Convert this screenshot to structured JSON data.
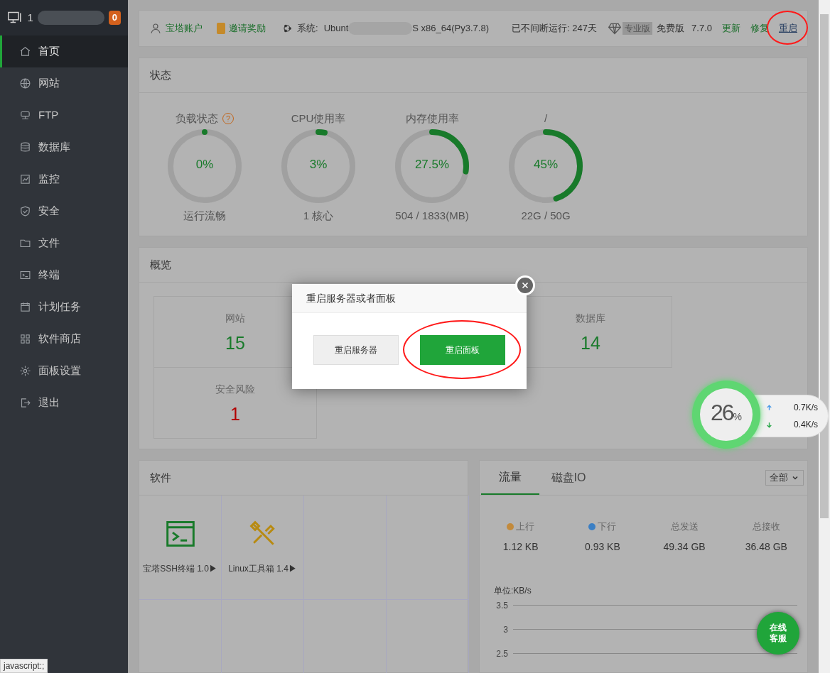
{
  "sidebar": {
    "host": "1",
    "badge": "0",
    "items": [
      {
        "label": "首页",
        "kind": "home",
        "selected": true
      },
      {
        "label": "网站",
        "kind": "globe",
        "selected": false
      },
      {
        "label": "FTP",
        "kind": "ftp",
        "selected": false
      },
      {
        "label": "数据库",
        "kind": "db",
        "selected": false
      },
      {
        "label": "监控",
        "kind": "chart",
        "selected": false
      },
      {
        "label": "安全",
        "kind": "shield",
        "selected": false
      },
      {
        "label": "文件",
        "kind": "folder",
        "selected": false
      },
      {
        "label": "终端",
        "kind": "terminal",
        "selected": false
      },
      {
        "label": "计划任务",
        "kind": "calendar",
        "selected": false
      },
      {
        "label": "软件商店",
        "kind": "grid",
        "selected": false
      },
      {
        "label": "面板设置",
        "kind": "gear",
        "selected": false
      },
      {
        "label": "退出",
        "kind": "exit",
        "selected": false
      }
    ]
  },
  "topbar": {
    "account": "宝塔账户",
    "invite": "邀请奖励",
    "system_label": "系统:",
    "system_start": "Ubunt",
    "system_end": "S x86_64(Py3.7.8)",
    "uptime": "已不间断运行: 247天",
    "pro_badge": "专业版",
    "edition": "免费版",
    "version": "7.7.0",
    "links": [
      {
        "label": "更新",
        "highlighted": false
      },
      {
        "label": "修复",
        "highlighted": false
      },
      {
        "label": "重启",
        "highlighted": true
      }
    ]
  },
  "status": {
    "title": "状态",
    "gauges": [
      {
        "label": "负载状态",
        "help": "?",
        "value": "0%",
        "level": 0,
        "detail": "运行流畅"
      },
      {
        "label": "CPU使用率",
        "value": "3%",
        "level": 0.03,
        "detail": "1 核心"
      },
      {
        "label": "内存使用率",
        "value": "27.5%",
        "level": 0.275,
        "detail": "504 / 1833(MB)"
      },
      {
        "label": "/",
        "value": "45%",
        "level": 0.45,
        "detail": "22G / 50G"
      }
    ]
  },
  "overview": {
    "title": "概览",
    "cells": [
      {
        "label": "网站",
        "value": "15",
        "alert": false
      },
      {
        "label": "数据库",
        "value": "14",
        "alert": false
      },
      {
        "label": "安全风险",
        "value": "1",
        "alert": true
      }
    ]
  },
  "software": {
    "title": "软件",
    "items": [
      {
        "label": "宝塔SSH终端 1.0▶",
        "kind": "terminal"
      },
      {
        "label": "Linux工具箱 1.4▶",
        "kind": "tools"
      }
    ]
  },
  "traffic": {
    "tabs": [
      {
        "label": "流量",
        "selected": true
      },
      {
        "label": "磁盘IO",
        "selected": false
      }
    ],
    "select": "全部",
    "stats": [
      {
        "label": "上行",
        "color": "#c28a3c",
        "value": "1.12 KB"
      },
      {
        "label": "下行",
        "color": "#3b7fc4",
        "value": "0.93 KB"
      },
      {
        "label": "总发送",
        "value": "49.34 GB"
      },
      {
        "label": "总接收",
        "value": "36.48 GB"
      }
    ],
    "unit": "单位:KB/s",
    "y_ticks": [
      "3.5",
      "3",
      "2.5"
    ]
  },
  "float_widget": {
    "percent": "26",
    "unit": "%",
    "up": "0.7K/s",
    "down": "0.4K/s"
  },
  "chat_button": {
    "line1": "在线",
    "line2": "客服"
  },
  "modal": {
    "title": "重启服务器或者面板",
    "buttons": [
      {
        "label": "重启服务器",
        "kind": "secondary",
        "highlighted": false
      },
      {
        "label": "重启面板",
        "kind": "primary",
        "highlighted": true
      }
    ]
  },
  "status_tip": "javascript:;"
}
